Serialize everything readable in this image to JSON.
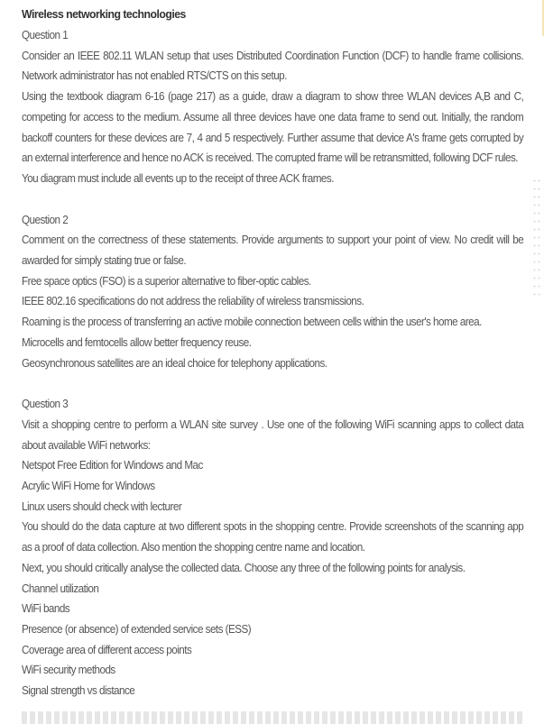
{
  "document": {
    "title": "Wireless networking technologies",
    "questions": [
      {
        "heading": "Question 1",
        "paragraphs": [
          "Consider an IEEE 802.11 WLAN setup that uses Distributed Coordination Function (DCF) to handle frame collisions. Network administrator has not enabled RTS/CTS on this setup.",
          "Using the textbook diagram 6-16 (page 217) as a guide, draw a diagram to show three WLAN devices A,B and C, competing for access to the medium. Assume all three devices have one data frame to send out. Initially, the random backoff counters for these devices are 7, 4 and 5 respectively. Further assume that device A's frame gets corrupted by an external interference and hence no ACK is received. The corrupted frame will be retransmitted, following DCF rules.",
          "You diagram must include all events up to the receipt of three ACK frames."
        ]
      },
      {
        "heading": "Question 2",
        "intro": "Comment on the correctness of these statements. Provide arguments to support your point of view. No credit will be awarded for simply stating true or false.",
        "statements": [
          "Free space optics (FSO) is a superior alternative to fiber-optic cables.",
          "IEEE 802.16 specifications do not address the reliability of wireless transmissions.",
          "Roaming is the process of transferring an active mobile connection between cells within the user's home area.",
          "Microcells and femtocells allow better frequency reuse.",
          "Geosynchronous satellites are an ideal choice for telephony applications."
        ]
      },
      {
        "heading": "Question 3",
        "intro": "Visit a shopping centre to perform a WLAN site survey . Use one of the following WiFi scanning apps to collect data about available WiFi networks:",
        "apps": [
          "Netspot Free Edition for Windows and Mac",
          "Acrylic WiFi Home for Windows",
          "Linux users should check with lecturer"
        ],
        "instructions": [
          "You should do the data capture at two different spots in the shopping centre. Provide screenshots of the scanning app as a proof of data collection. Also mention the shopping centre name and location.",
          "Next, you should critically analyse the collected data. Choose any three of the following points for analysis."
        ],
        "analysis_points": [
          "Channel utilization",
          "WiFi bands",
          "Presence (or absence) of extended service sets (ESS)",
          "Coverage area of different access points",
          "WiFi security methods",
          "Signal strength vs distance"
        ]
      }
    ]
  }
}
